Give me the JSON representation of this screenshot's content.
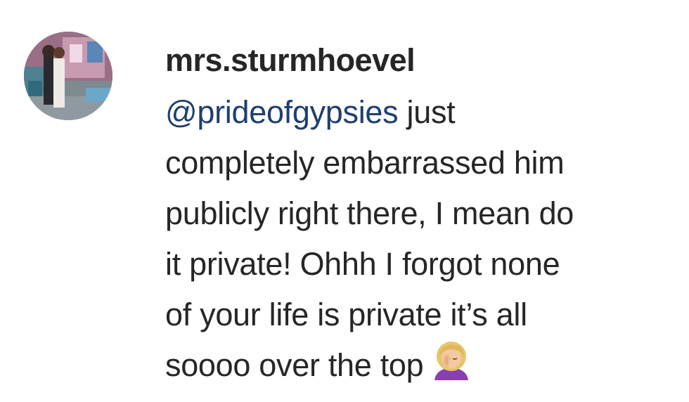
{
  "comment": {
    "username": "mrs.sturmhoevel",
    "mention": "@prideofgypsies",
    "lines": [
      " just",
      "completely embarrassed him",
      "publicly right there, I mean do",
      "it private! Ohhh I forgot none",
      "of your life is private it’s all",
      "soooo over the top"
    ],
    "emoji": "woman-facepalming-emoji"
  }
}
